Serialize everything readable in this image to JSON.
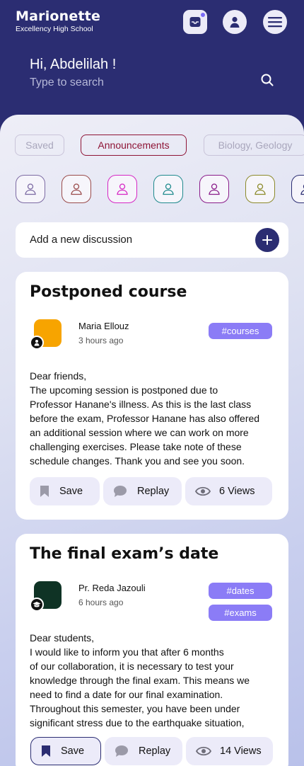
{
  "header": {
    "app_name": "Marionette",
    "school": "Excellency High School",
    "greeting": "Hi, Abdelilah !",
    "search_placeholder": "Type to search"
  },
  "filters": [
    {
      "label": "Saved",
      "state": "inactive"
    },
    {
      "label": "Announcements",
      "state": "active"
    },
    {
      "label": "Biology, Geology",
      "state": "inactive"
    }
  ],
  "avatar_colors": [
    "#7c6aa3",
    "#9a4b4b",
    "#d627c4",
    "#1f8a8d",
    "#8a1c8a",
    "#8c8a2a",
    "#2b2d72"
  ],
  "add_discussion": {
    "label": "Add a new discussion"
  },
  "posts": [
    {
      "title": "Postponed course",
      "author": "Maria Ellouz",
      "time": "3 hours ago",
      "avatar_color": "#f7a400",
      "role_icon": "person-icon",
      "tags": [
        "#courses"
      ],
      "body_lines": [
        "Dear friends,",
        "The upcoming session is postponed due to",
        "Professor Hanane's illness. As this is the last class",
        "before the exam, Professor Hanane has also offered",
        "an additional session where we can work on more",
        "challenging exercises. Please take note of these",
        "schedule changes. Thank you and see you soon."
      ],
      "actions": {
        "save": "Save",
        "reply": "Replay",
        "views": "6 Views"
      },
      "saved": false
    },
    {
      "title": "The final exam’s date",
      "author": "Pr. Reda Jazouli",
      "time": "6 hours ago",
      "avatar_color": "#0f3325",
      "role_icon": "graduation-cap-icon",
      "tags": [
        "#dates",
        "#exams"
      ],
      "body_lines": [
        "Dear students,",
        "I would like to inform you that after 6 months",
        "of our collaboration, it is necessary to test your",
        "knowledge through the final exam. This means we",
        "need to find a date for our final examination.",
        "Throughout this semester, you have been under",
        "significant stress due to the earthquake situation,"
      ],
      "actions": {
        "save": "Save",
        "reply": "Replay",
        "views": "14 Views"
      },
      "saved": true
    }
  ]
}
